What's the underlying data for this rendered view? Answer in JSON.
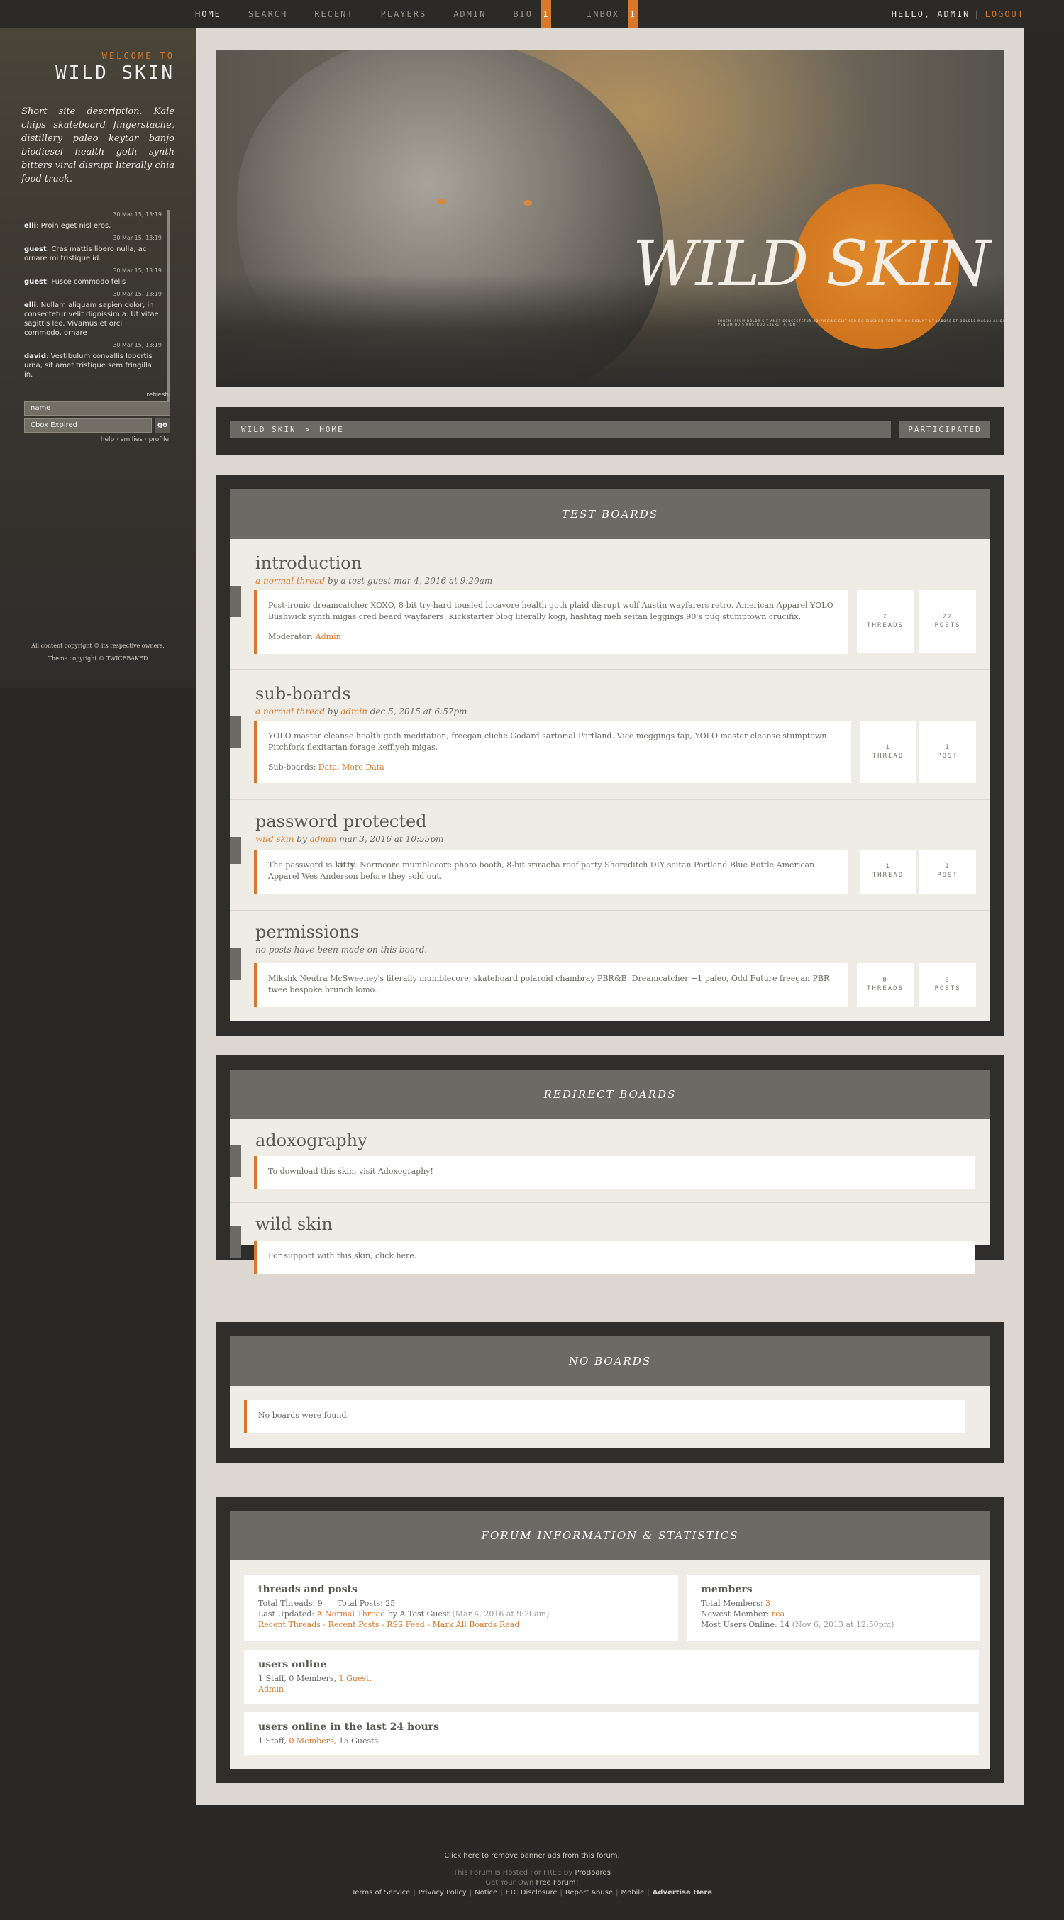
{
  "nav": {
    "items": [
      {
        "label": "HOME"
      },
      {
        "label": "SEARCH"
      },
      {
        "label": "RECENT"
      },
      {
        "label": "PLAYERS"
      },
      {
        "label": "ADMIN"
      },
      {
        "label": "BIO",
        "count": "1"
      },
      {
        "label": "INBOX",
        "count": "1"
      }
    ],
    "greeting": "HELLO, ADMIN",
    "separator": "|",
    "logout": "LOGOUT"
  },
  "sidebar": {
    "welcome": "WELCOME TO",
    "site_name": "WILD SKIN",
    "description": "Short site description. Kale chips skateboard fingerstache, distillery paleo keytar banjo biodiesel health goth synth bitters viral disrupt literally chia food truck.",
    "cbox": [
      {
        "time": "30 Mar 15, 13:19",
        "user": "elli",
        "text": "Proin eget nisl eros."
      },
      {
        "time": "30 Mar 15, 13:19",
        "user": "guest",
        "text": "Cras mattis libero nulla, ac ornare mi tristique id."
      },
      {
        "time": "30 Mar 15, 13:19",
        "user": "guest",
        "text": "Fusce commodo felis"
      },
      {
        "time": "30 Mar 15, 13:19",
        "user": "elli",
        "text": "Nullam aliquam sapien dolor, in consectetur velit dignissim a. Ut vitae sagittis leo. Vivamus et orci commodo, ornare"
      },
      {
        "time": "30 Mar 15, 13:19",
        "user": "david",
        "text": "Vestibulum convallis lobortis urna, sit amet tristique sem fringilla in."
      }
    ],
    "refresh": "refresh",
    "name_placeholder": "name",
    "message_placeholder": "Cbox Expired",
    "go": "go",
    "links": "help · smilies · profile",
    "copyright": "All content copyright © its respective owners.",
    "theme_copyright": "Theme copyright © TWICEBAKED"
  },
  "banner": {
    "title": "WILD SKIN",
    "tagline": "LOREM IPSUM DOLOR SIT AMET CONSECTETUR ADIPISCING ELIT SED DO EIUSMOD TEMPOR INCIDIDUNT UT LABORE ET DOLORE MAGNA ALIQUA UT ENIM AD MINIM VENIAM QUIS NOSTRUD EXERCITATION"
  },
  "breadcrumb": {
    "root": "WILD SKIN",
    "sep": ">",
    "current": "HOME",
    "participated": "PARTICIPATED"
  },
  "categories": {
    "test": {
      "title": "TEST BOARDS",
      "boards": [
        {
          "name": "introduction",
          "last_thread": "a normal thread",
          "by": "by",
          "last_user": "a test guest",
          "date": "mar 4, 2016 at 9:20am",
          "description": "Post-ironic dreamcatcher XOXO, 8-bit try-hard tousled locavore health goth plaid disrupt wolf Austin wayfarers retro. American Apparel YOLO Bushwick synth migas cred beard wayfarers. Kickstarter blog literally kogi, hashtag meh seitan leggings 90's pug stumptown crucifix.",
          "mods_label": "Moderator:",
          "mods": "Admin",
          "threads": "7",
          "threads_label": "THREADS",
          "posts": "22",
          "posts_label": "POSTS"
        },
        {
          "name": "sub-boards",
          "last_thread": "a normal thread",
          "by": "by",
          "last_user": "admin",
          "date": "dec 5, 2015 at 6:57pm",
          "description": "YOLO master cleanse health goth meditation, freegan cliche Godard sartorial Portland. Vice meggings fap, YOLO master cleanse stumptown Pitchfork flexitarian forage keffiyeh migas.",
          "mods_label": "Sub-boards:",
          "mods": "Data, More Data",
          "threads": "1",
          "threads_label": "THREAD",
          "posts": "1",
          "posts_label": "POST"
        },
        {
          "name": "password protected",
          "last_thread": "wild skin",
          "by": "by",
          "last_user": "admin",
          "date": "mar 3, 2016 at 10:55pm",
          "description_pre": "The password is ",
          "password": "kitty",
          "description_post": ". Normcore mumblecore photo booth, 8-bit sriracha roof party Shoreditch DIY seitan Portland Blue Bottle American Apparel Wes Anderson before they sold out.",
          "threads": "1",
          "threads_label": "THREAD",
          "posts": "2",
          "posts_label": "POST"
        },
        {
          "name": "permissions",
          "no_posts": "no posts have been made on this board.",
          "description": "Mlkshk Neutra McSweeney's literally mumblecore, skateboard polaroid chambray PBR&B. Dreamcatcher +1 paleo, Odd Future freegan PBR twee bespoke brunch lomo.",
          "threads": "0",
          "threads_label": "THREADS",
          "posts": "0",
          "posts_label": "POSTS"
        }
      ]
    },
    "redirect": {
      "title": "REDIRECT BOARDS",
      "boards": [
        {
          "name": "adoxography",
          "description": "To download this skin, visit Adoxography!"
        },
        {
          "name": "wild skin",
          "description": "For support with this skin, click here."
        }
      ]
    },
    "none": {
      "title": "NO BOARDS",
      "message": "No boards were found."
    }
  },
  "stats": {
    "title": "FORUM INFORMATION & STATISTICS",
    "threads": {
      "heading": "threads and posts",
      "total_threads": "Total Threads: 9",
      "total_posts": "Total Posts: 25",
      "last_updated_label": "Last Updated:",
      "last_thread": "A Normal Thread",
      "by_user": "by A Test Guest",
      "date": "(Mar 4, 2016 at 9:20am)",
      "links": "Recent Threads - Recent Posts - RSS Feed - Mark All Boards Read"
    },
    "members": {
      "heading": "members",
      "total_label": "Total Members:",
      "total": "3",
      "newest_label": "Newest Member:",
      "newest": "rea",
      "most_label": "Most Users Online:",
      "most": "14",
      "most_date": "(Nov 6, 2013 at 12:50pm)"
    },
    "online": {
      "heading": "users online",
      "text": "1 Staff, 0 Members,",
      "guests": "1 Guest.",
      "user": "Admin"
    },
    "online24": {
      "heading": "users online in the last 24 hours",
      "text_pre": "1 Staff,",
      "members": "0 Members,",
      "text_post": "15 Guests."
    }
  },
  "footer": {
    "remove_ads": "Click here to remove banner ads from this forum.",
    "hosted": "This Forum Is Hosted For FREE By",
    "proboards": "ProBoards",
    "get_own": "Get Your Own",
    "free_forum": "Free Forum!",
    "links": [
      "Terms of Service",
      "Privacy Policy",
      "Notice",
      "FTC Disclosure",
      "Report Abuse",
      "Mobile",
      "Advertise Here"
    ]
  }
}
